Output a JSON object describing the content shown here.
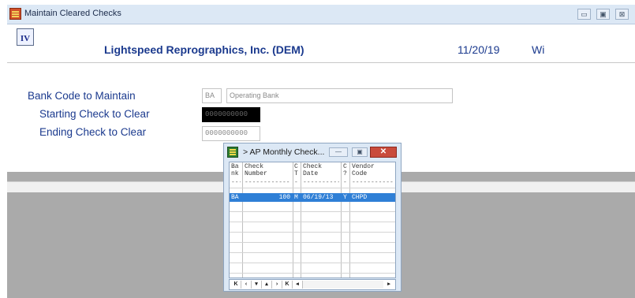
{
  "window": {
    "title": "Maintain Cleared Checks",
    "controls": {
      "minimize": "▭",
      "maximize": "▣",
      "close": "⊠"
    }
  },
  "header": {
    "logo_text": "IV",
    "company": "Lightspeed Reprographics, Inc. (DEM)",
    "date": "11/20/19",
    "user": "Wi"
  },
  "form": {
    "bank_code_label": "Bank Code to Maintain",
    "bank_code_value": "BA",
    "bank_name_value": "Operating Bank",
    "starting_check_label": "Starting Check to Clear",
    "starting_check_value": "0000000000",
    "ending_check_label": "Ending Check to Clear",
    "ending_check_value": "0000000000"
  },
  "popup": {
    "title": "> AP Monthly Check...",
    "controls": {
      "minimize": "—",
      "maximize": "▣",
      "close": "✕"
    },
    "columns": [
      {
        "line1": "Ba",
        "line2": "nk"
      },
      {
        "line1": "Check",
        "line2": "Number"
      },
      {
        "line1": "C",
        "line2": "T"
      },
      {
        "line1": "Check",
        "line2": "Date"
      },
      {
        "line1": "C",
        "line2": "?"
      },
      {
        "line1": "Vendor",
        "line2": "Code"
      }
    ],
    "rows": [
      {
        "bank": "BA",
        "check_number": "100",
        "ct": "M",
        "check_date": "06/19/13",
        "cleared": "Y",
        "vendor": "CHPD"
      }
    ],
    "nav_buttons": [
      "K",
      "‹",
      "▾",
      "▴",
      "›",
      "K",
      "◂",
      "▸"
    ]
  }
}
